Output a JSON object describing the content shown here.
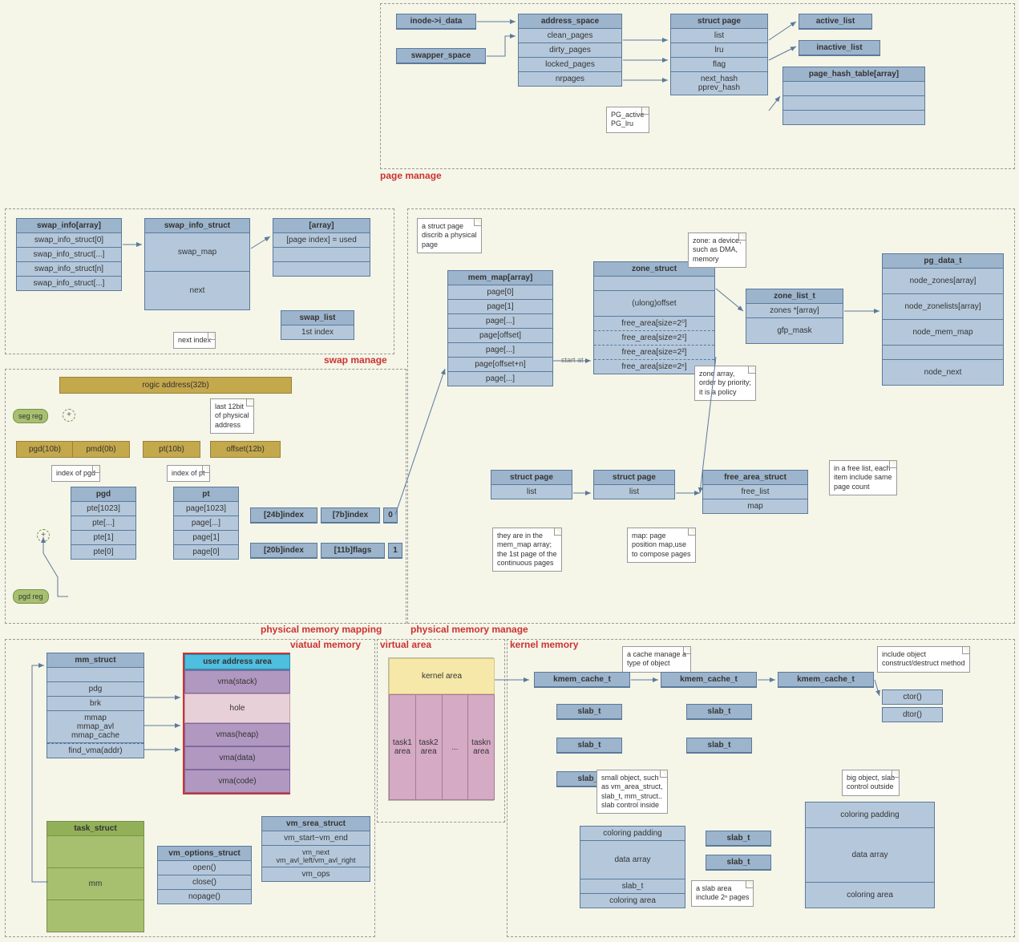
{
  "regions": {
    "page_manage": "page manage",
    "swap_manage": "swap manage",
    "phys_mapping": "physical memory mapping",
    "phys_manage": "physical memory manage",
    "virtual_memory": "viatual memory",
    "virtual_area": "virtual area",
    "kernel_memory": "kernel memory"
  },
  "page_manage": {
    "inode": "inode->i_data",
    "swapper": "swapper_space",
    "address_space": {
      "t": "address_space",
      "rows": [
        "clean_pages",
        "dirty_pages",
        "locked_pages",
        "nrpages"
      ]
    },
    "struct_page": {
      "t": "struct page",
      "rows": [
        "list",
        "lru",
        "flag",
        "next_hash\npprev_hash"
      ]
    },
    "active_list": "active_list",
    "inactive_list": "inactive_list",
    "page_hash": {
      "t": "page_hash_table[array]",
      "rows": [
        "",
        "",
        ""
      ]
    },
    "note_pg": "PG_active\nPG_lru"
  },
  "swap_manage": {
    "swap_info": {
      "t": "swap_info[array]",
      "rows": [
        "swap_info_struct[0]",
        "swap_info_struct[...]",
        "swap_info_struct[n]",
        "swap_info_struct[...]"
      ]
    },
    "swap_info_struct": {
      "t": "swap_info_struct",
      "rows": [
        "swap_map",
        "next"
      ]
    },
    "array": {
      "t": "[array]",
      "rows": [
        "[page index] = used",
        "",
        ""
      ]
    },
    "swap_list": {
      "t": "swap_list",
      "rows": [
        "1st index"
      ]
    },
    "note_next": "next index"
  },
  "phys_mapping": {
    "rogic": "rogic address(32b)",
    "seg_reg": "seg reg",
    "pgd_reg": "pgd reg",
    "parts": [
      "pgd(10b)",
      "pmd(0b)",
      "pt(10b)",
      "offset(12b)"
    ],
    "note_12b": "last 12bit\nof physical\naddress",
    "note_ipgd": "index of pgd",
    "note_ipt": "index of pt",
    "pgd": {
      "t": "pgd",
      "rows": [
        "pte[1023]",
        "pte[...]",
        "pte[1]",
        "pte[0]"
      ]
    },
    "pt": {
      "t": "pt",
      "rows": [
        "page[1023]",
        "page[...]",
        "page[1]",
        "page[0]"
      ]
    },
    "pte0": [
      "[24b]index",
      "[7b]index",
      "0"
    ],
    "pte1": [
      "[20b]index",
      "[11b]flags",
      "1"
    ]
  },
  "phys_manage": {
    "note_struct_page": "a struct page\ndiscrib a physical\npage",
    "mem_map": {
      "t": "mem_map[array]",
      "rows": [
        "page[0]",
        "page[1]",
        "page[...]",
        "page[offset]",
        "page[...]",
        "page[offset+n]",
        "page[...]"
      ]
    },
    "zone_struct": {
      "t": "zone_struct",
      "rows": [
        "",
        "(ulong)offset",
        "free_area[size=2⁰]",
        "free_area[size=2¹]",
        "free_area[size=2²]",
        "free_area[size=2ⁿ]"
      ]
    },
    "note_zone": "zone: a device,\nsuch as DMA,\nmemory",
    "zone_list_t": {
      "t": "zone_list_t",
      "rows": [
        "zones *[array]",
        "gfp_mask"
      ]
    },
    "note_zarr": "zone array,\norder by priority;\nit is a policy",
    "pg_data_t": {
      "t": "pg_data_t",
      "rows": [
        "node_zones[array]",
        "node_zonelists[array]",
        "node_mem_map",
        "",
        "node_next"
      ]
    },
    "sp1": {
      "t": "struct page",
      "rows": [
        "list"
      ]
    },
    "sp2": {
      "t": "struct page",
      "rows": [
        "list"
      ]
    },
    "free_area": {
      "t": "free_area_struct",
      "rows": [
        "free_list",
        "map"
      ]
    },
    "note_free": "in a free list, each\nitem include same\npage count",
    "note_sp": "they are in the\nmem_map array;\nthe 1st page of the\ncontinuous pages",
    "note_map": "map: page\nposition map,use\nto compose pages",
    "start_at": "start at"
  },
  "virtual_memory": {
    "mm_struct": {
      "t": "mm_struct",
      "rows": [
        "",
        "pdg",
        "brk",
        "mmap\nmmap_avl\nmmap_cache",
        "find_vma(addr)"
      ]
    },
    "task_struct": {
      "t": "task_struct",
      "rows": [
        "",
        "mm",
        ""
      ]
    },
    "vm_options": {
      "t": "vm_options_struct",
      "rows": [
        "open()",
        "close()",
        "nopage()"
      ]
    },
    "vm_srea": {
      "t": "vm_srea_struct",
      "rows": [
        "vm_start~vm_end",
        "vm_next\nvm_avl_left/vm_avl_right",
        "vm_ops"
      ]
    },
    "uaa": "user address area",
    "vmas": [
      "vma(stack)",
      "hole",
      "vmas(heap)",
      "vma(data)",
      "vma(code)"
    ]
  },
  "virtual_area": {
    "kernel": "kernel area",
    "tasks": [
      "task1\narea",
      "task2\narea",
      "...",
      "taskn\narea"
    ]
  },
  "kernel_memory": {
    "kmem": "kmem_cache_t",
    "slab": "slab_t",
    "note_cache": "a cache manage a\ntype of object",
    "note_ctor": "include object\nconstruct/destruct method",
    "ctor": "ctor()",
    "dtor": "dtor()",
    "a_box": {
      "rows": [
        "coloring padding",
        "data array",
        "slab_t",
        "coloring area"
      ]
    },
    "b_box": {
      "rows": [
        "coloring padding",
        "data array",
        "coloring area"
      ]
    },
    "note_small": "small object, such\nas vm_area_struct,\nslab_t, mm_struct..\nslab control inside",
    "note_big": "big object, slab\ncontrol outside",
    "note_slab": "a slab area\ninclude 2ⁿ pages"
  }
}
